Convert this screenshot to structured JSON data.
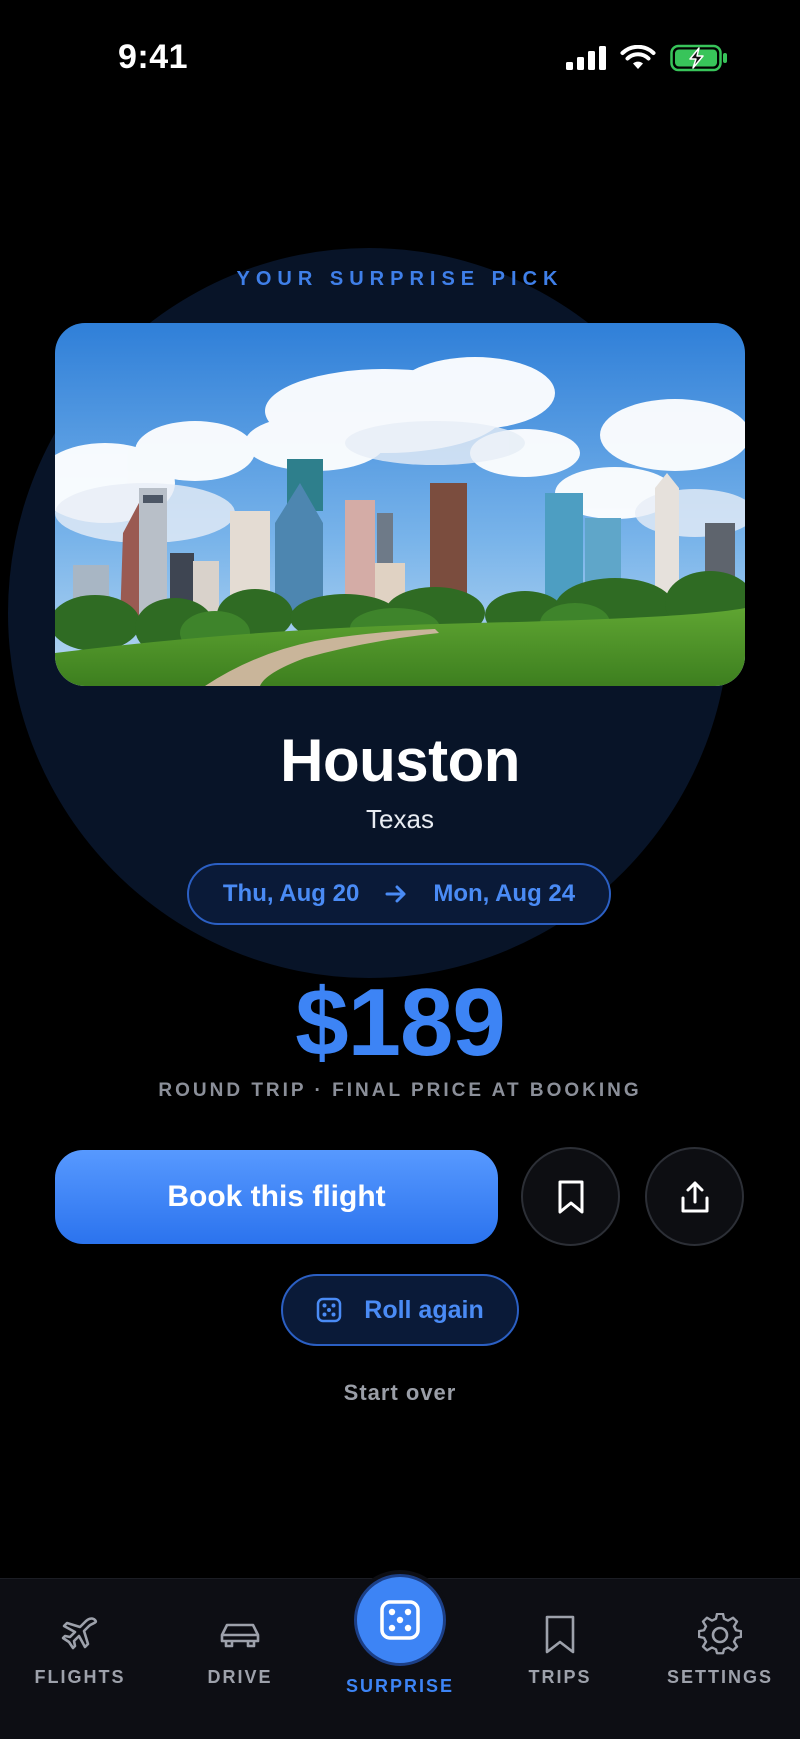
{
  "status_bar": {
    "time": "9:41",
    "icons": [
      "cellular-signal-icon",
      "wifi-icon",
      "battery-charging-icon"
    ],
    "battery_color": "#38c45a"
  },
  "hero": {
    "eyebrow": "YOUR SURPRISE PICK",
    "photo_alt": "Houston skyline",
    "city": "Houston",
    "region": "Texas",
    "dates": {
      "depart": "Thu, Aug 20",
      "return": "Mon, Aug 24",
      "arrow_icon": "arrow-right-icon"
    }
  },
  "pricing": {
    "price": "$189",
    "note": "ROUND TRIP · FINAL PRICE AT BOOKING"
  },
  "actions": {
    "book_label": "Book this flight",
    "save_icon": "bookmark-icon",
    "share_icon": "share-icon",
    "roll_label": "Roll again",
    "roll_icon": "dice-icon",
    "start_over_label": "Start over"
  },
  "tabbar": {
    "active": "surprise",
    "tabs": [
      {
        "id": "flights",
        "label": "FLIGHTS",
        "icon": "airplane-icon"
      },
      {
        "id": "drive",
        "label": "DRIVE",
        "icon": "car-icon"
      },
      {
        "id": "surprise",
        "label": "SURPRISE",
        "icon": "dice-icon"
      },
      {
        "id": "trips",
        "label": "TRIPS",
        "icon": "bookmark-icon"
      },
      {
        "id": "settings",
        "label": "SETTINGS",
        "icon": "gear-icon"
      }
    ]
  },
  "colors": {
    "accent": "#3d84f5",
    "background": "#000000",
    "muted": "#8b8f99"
  }
}
